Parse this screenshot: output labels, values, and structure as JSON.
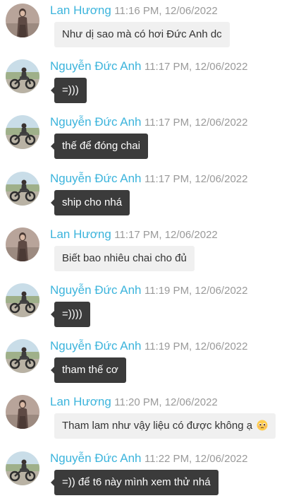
{
  "messages": [
    {
      "sender": "Lan Hương",
      "time": "11:16 PM, 12/06/2022",
      "text": "Như dị sao mà có hơi Đức Anh dc",
      "avatar": "woman-avatar",
      "style": "light"
    },
    {
      "sender": "Nguyễn Đức Anh",
      "time": "11:17 PM, 12/06/2022",
      "text": "=)))",
      "avatar": "motorbike-avatar",
      "style": "dark"
    },
    {
      "sender": "Nguyễn Đức Anh",
      "time": "11:17 PM, 12/06/2022",
      "text": "thế để đóng chai",
      "avatar": "motorbike-avatar",
      "style": "dark"
    },
    {
      "sender": "Nguyễn Đức Anh",
      "time": "11:17 PM, 12/06/2022",
      "text": "ship cho nhá",
      "avatar": "motorbike-avatar",
      "style": "dark"
    },
    {
      "sender": "Lan Hương",
      "time": "11:17 PM, 12/06/2022",
      "text": "Biết bao nhiêu chai cho đủ",
      "avatar": "woman-avatar",
      "style": "light"
    },
    {
      "sender": "Nguyễn Đức Anh",
      "time": "11:19 PM, 12/06/2022",
      "text": "=))))",
      "avatar": "motorbike-avatar",
      "style": "dark"
    },
    {
      "sender": "Nguyễn Đức Anh",
      "time": "11:19 PM, 12/06/2022",
      "text": "tham thế cơ",
      "avatar": "motorbike-avatar",
      "style": "dark"
    },
    {
      "sender": "Lan Hương",
      "time": "11:20 PM, 12/06/2022",
      "text": "Tham lam như vậy liệu có được không ạ",
      "avatar": "woman-avatar",
      "style": "light",
      "emoji": "pleading-face-icon"
    },
    {
      "sender": "Nguyễn Đức Anh",
      "time": "11:22 PM, 12/06/2022",
      "text": "=)) để t6 này mình xem thử nhá",
      "avatar": "motorbike-avatar",
      "style": "dark"
    }
  ],
  "colors": {
    "sender_name": "#3cb4dc",
    "timestamp": "#9a9a9a",
    "light_bubble": "#f0f0f0",
    "dark_bubble": "#3b3b3b"
  }
}
